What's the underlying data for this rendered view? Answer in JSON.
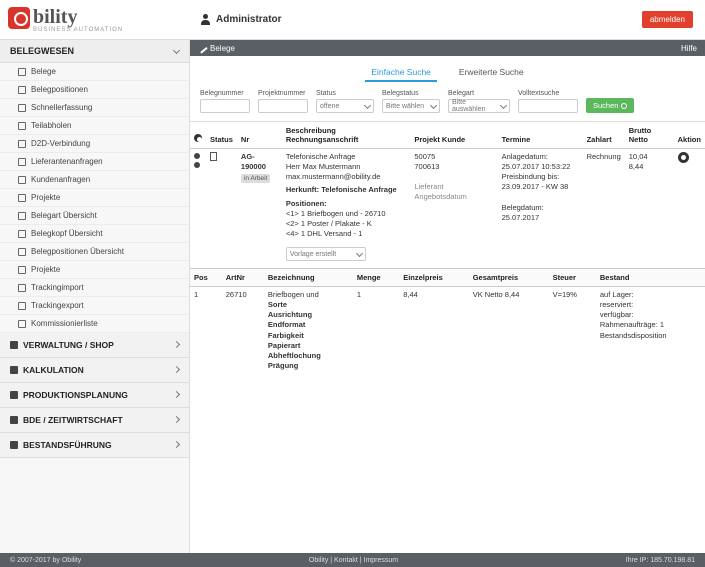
{
  "app": {
    "logo_text": "bility",
    "logo_sub": "BUSINESS AUTOMATION",
    "user": "Administrator",
    "logout_label": "abmelden"
  },
  "sidebar": {
    "head": "BELEGWESEN",
    "items": [
      "Belege",
      "Belegpositionen",
      "Schnellerfassung",
      "Teilabholen",
      "D2D-Verbindung",
      "Lieferantenanfragen",
      "Kundenanfragen",
      "Projekte",
      "Belegart Übersicht",
      "Belegkopf Übersicht",
      "Belegpositionen Übersicht",
      "Projekte",
      "Trackingimport",
      "Trackingexport",
      "Kommissionierliste"
    ],
    "sections": [
      "VERWALTUNG / SHOP",
      "KALKULATION",
      "PRODUKTIONSPLANUNG",
      "BDE / ZEITWIRTSCHAFT",
      "BESTANDSFÜHRUNG"
    ]
  },
  "subbar": {
    "title": "Belege",
    "help": "Hilfe"
  },
  "tabs": [
    "Einfache Suche",
    "Erweiterte Suche"
  ],
  "filters": {
    "belegnummer": {
      "label": "Belegnummer",
      "value": ""
    },
    "projektnummer": {
      "label": "Projektnummer",
      "value": ""
    },
    "status": {
      "label": "Status",
      "value": "offene"
    },
    "belegstatus": {
      "label": "Belegstatus",
      "value": "Bitte wählen"
    },
    "belegart": {
      "label": "Belegart",
      "value": "Bitte auswählen"
    },
    "volltextsuche": {
      "label": "Volltextsuche",
      "value": ""
    },
    "search_label": "Suchen"
  },
  "table": {
    "headers": [
      "Status",
      "Nr",
      "Beschreibung Rechnungsanschrift",
      "Projekt Kunde",
      "Termine",
      "Zahlart",
      "Brutto Netto",
      "Aktion"
    ],
    "row": {
      "nr": "AG-190000",
      "status_badge": "in Arbeit",
      "desc_lines": [
        "Telefonische Anfrage",
        "Herr Max Mustermann",
        "max.mustermann@obility.de"
      ],
      "herkunft": "Herkunft: Telefonische Anfrage",
      "positionen_label": "Positionen:",
      "positionen": [
        "<1> 1 Briefbogen und - 26710",
        "<2> 1 Poster / Plakate - K",
        "<4> 1 DHL Versand - 1"
      ],
      "projekt": [
        "50075",
        "700613"
      ],
      "lieferant": "Lieferant Angebotsdatum",
      "termine": [
        "Anlagedatum:",
        "25.07.2017 10:53:22",
        "Preisbindung bis:",
        "23.09.2017 - KW 38"
      ],
      "zahlart": "Rechnung",
      "brutto": "10,04",
      "netto": "8,44",
      "belegdatum": "Belegdatum: 25.07.2017",
      "bottom_select": "Vorlage erstellt"
    }
  },
  "positions": {
    "headers": [
      "Pos",
      "ArtNr",
      "Bezeichnung",
      "Menge",
      "Einzelpreis",
      "Gesamtpreis",
      "Steuer",
      "Bestand"
    ],
    "row": {
      "pos": "1",
      "artnr": "26710",
      "bezeichnung_main": "Briefbogen und",
      "bezeichnung_list": [
        "Sorte",
        "Ausrichtung",
        "Endformat",
        "Farbigkeit",
        "Papierart",
        "Abheftlochung",
        "Prägung"
      ],
      "menge": "1",
      "einzelpreis": "8,44",
      "gesamtpreis": "VK Netto 8,44",
      "steuer": "V=19%",
      "bestand": [
        "auf Lager:",
        "reserviert:",
        "verfügbar:",
        "Rahmenaufträge: 1",
        "Bestandsdisposition"
      ]
    }
  },
  "footer": {
    "left": "© 2007-2017 by Obility",
    "center": "Obility | Kontakt | Impressum",
    "right": "Ihre IP: 185.70.198.81"
  }
}
